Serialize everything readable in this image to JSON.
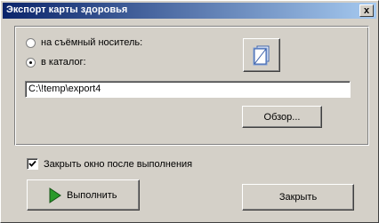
{
  "window": {
    "title": "Экспорт карты здоровья",
    "close_glyph": "x"
  },
  "destination": {
    "options": [
      {
        "label": "на съёмный носитель:",
        "selected": false
      },
      {
        "label": "в каталог:",
        "selected": true
      }
    ],
    "path_value": "C:\\!temp\\export4",
    "browse_label": "Обзор..."
  },
  "close_after_checkbox": {
    "label": "Закрыть окно после выполнения",
    "checked": true
  },
  "actions": {
    "run_label": "Выполнить",
    "close_label": "Закрыть"
  },
  "icons": {
    "copy": "copy-pages-icon",
    "run": "play-triangle-icon",
    "run_color": "#2a9a2a"
  }
}
